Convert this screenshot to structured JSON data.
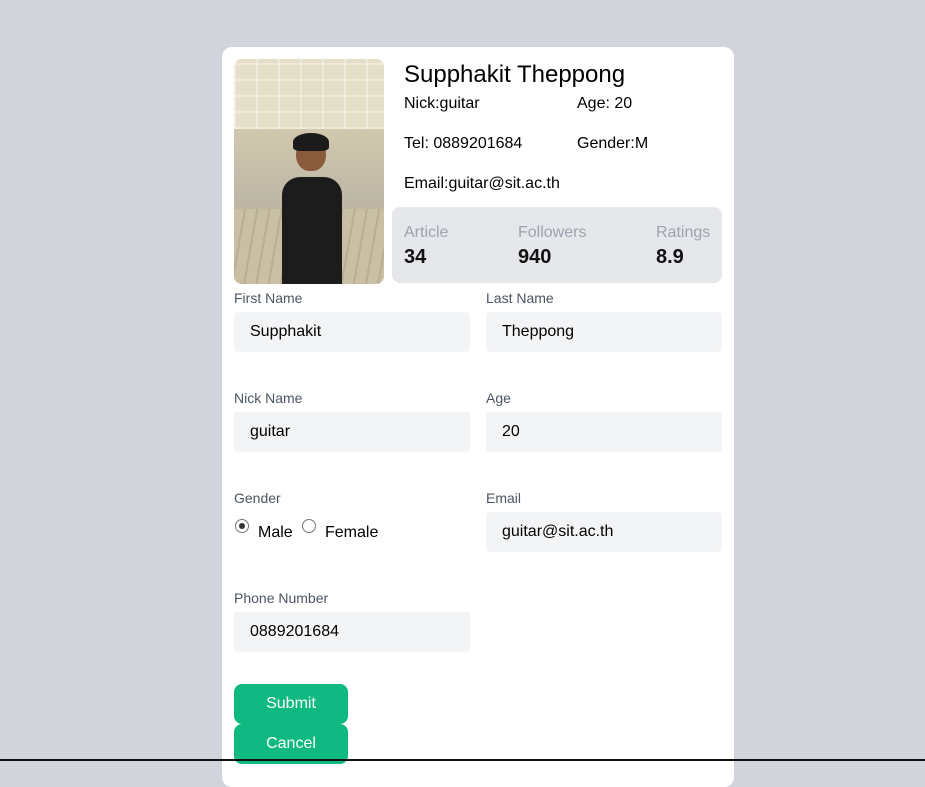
{
  "profile": {
    "name": "Supphakit Theppong",
    "nick": "Nick:guitar",
    "age": "Age: 20",
    "tel": "Tel: 0889201684",
    "gender": "Gender:M",
    "email": "Email:guitar@sit.ac.th"
  },
  "stats": [
    {
      "label": "Article",
      "value": "34"
    },
    {
      "label": "Followers",
      "value": "940"
    },
    {
      "label": "Ratings",
      "value": "8.9"
    }
  ],
  "form": {
    "first_name": {
      "label": "First Name",
      "value": "Supphakit"
    },
    "last_name": {
      "label": "Last Name",
      "value": "Theppong"
    },
    "nick_name": {
      "label": "Nick Name",
      "value": "guitar"
    },
    "age": {
      "label": "Age",
      "value": "20"
    },
    "gender": {
      "label": "Gender",
      "options": [
        "Male",
        "Female"
      ],
      "selected": "Male"
    },
    "email": {
      "label": "Email",
      "value": "guitar@sit.ac.th"
    },
    "phone": {
      "label": "Phone Number",
      "value": "0889201684"
    }
  },
  "buttons": {
    "submit": "Submit",
    "cancel": "Cancel"
  },
  "colors": {
    "page_background": "#d1d5db",
    "stats_background": "#e5e7eb",
    "input_background": "#f3f4f6",
    "button": "#10b981"
  }
}
